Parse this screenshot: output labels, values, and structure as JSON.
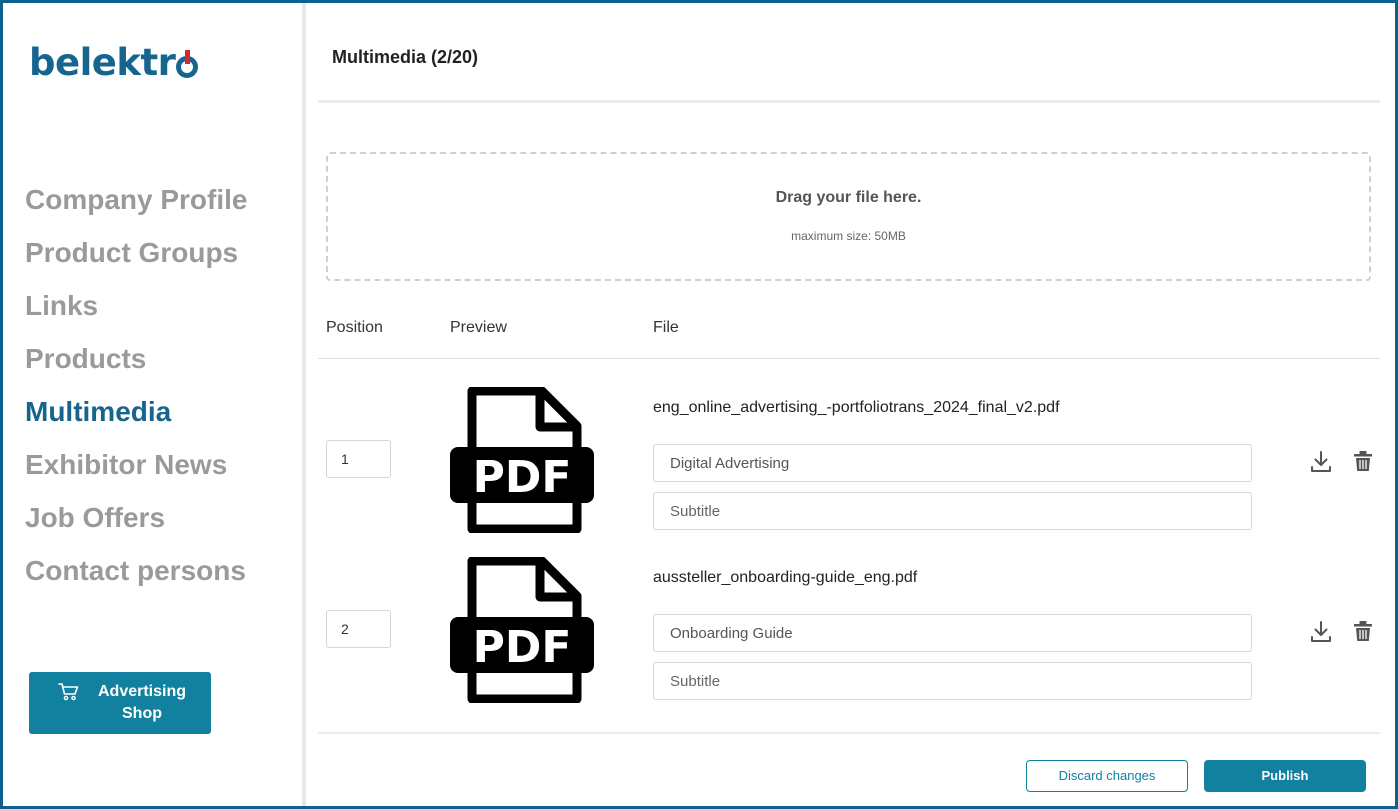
{
  "brand": {
    "logo_text": "belektr",
    "logo_letter": "o"
  },
  "sidebar": {
    "items": [
      {
        "label": "Company Profile",
        "active": false
      },
      {
        "label": "Product Groups",
        "active": false
      },
      {
        "label": "Links",
        "active": false
      },
      {
        "label": "Products",
        "active": false
      },
      {
        "label": "Multimedia",
        "active": true
      },
      {
        "label": "Exhibitor News",
        "active": false
      },
      {
        "label": "Job Offers",
        "active": false
      },
      {
        "label": "Contact persons",
        "active": false
      }
    ],
    "shop_button": {
      "label": "Advertising Shop",
      "icon": "cart-icon"
    }
  },
  "main": {
    "title": "Multimedia (2/20)",
    "dropzone": {
      "title": "Drag your file here.",
      "subtitle": "maximum size: 50MB"
    },
    "columns": [
      "Position",
      "Preview",
      "File"
    ],
    "files": [
      {
        "position": "1",
        "preview": "pdf-icon",
        "filename": "eng_online_advertising_-portfoliotrans_2024_final_v2.pdf",
        "title_value": "Digital Advertising",
        "subtitle_placeholder": "Subtitle"
      },
      {
        "position": "2",
        "preview": "pdf-icon",
        "filename": "aussteller_onboarding-guide_eng.pdf",
        "title_value": "Onboarding Guide",
        "subtitle_placeholder": "Subtitle"
      }
    ],
    "actions": {
      "discard_label": "Discard changes",
      "publish_label": "Publish"
    }
  },
  "colors": {
    "brand_blue": "#15658f",
    "accent_teal": "#11819f",
    "logo_red": "#d7262e",
    "inactive_nav": "#9a9a9a"
  }
}
